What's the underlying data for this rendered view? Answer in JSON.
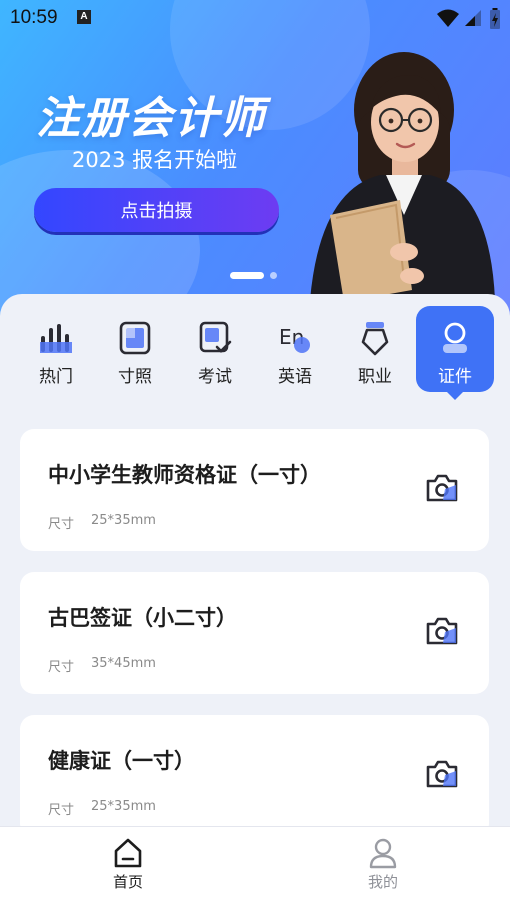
{
  "status_bar": {
    "time": "10:59",
    "badge": "A"
  },
  "banner": {
    "headline": "注册会计师",
    "subline": "2023 报名开始啦",
    "cta_label": "点击拍摄",
    "carousel_dots": 2,
    "active_dot": 0
  },
  "categories": [
    {
      "label": "热门",
      "icon": "bar-chart-icon"
    },
    {
      "label": "寸照",
      "icon": "photo-frame-icon"
    },
    {
      "label": "考试",
      "icon": "exam-check-icon"
    },
    {
      "label": "英语",
      "icon": "english-icon"
    },
    {
      "label": "职业",
      "icon": "badge-icon"
    },
    {
      "label": "证件",
      "icon": "id-person-icon",
      "active": true
    }
  ],
  "cards": [
    {
      "title": "中小学生教师资格证（一寸）",
      "size_label": "尺寸",
      "size_value": "25*35mm"
    },
    {
      "title": "古巴签证（小二寸）",
      "size_label": "尺寸",
      "size_value": "35*45mm"
    },
    {
      "title": "健康证（一寸）",
      "size_label": "尺寸",
      "size_value": "25*35mm"
    }
  ],
  "tabs": [
    {
      "label": "首页",
      "icon": "home-icon",
      "active": true
    },
    {
      "label": "我的",
      "icon": "user-icon",
      "active": false
    }
  ],
  "colors": {
    "accent": "#3f72f6",
    "cta_start": "#3347ff",
    "cta_end": "#6d3cf2",
    "background": "#eef1f8"
  }
}
